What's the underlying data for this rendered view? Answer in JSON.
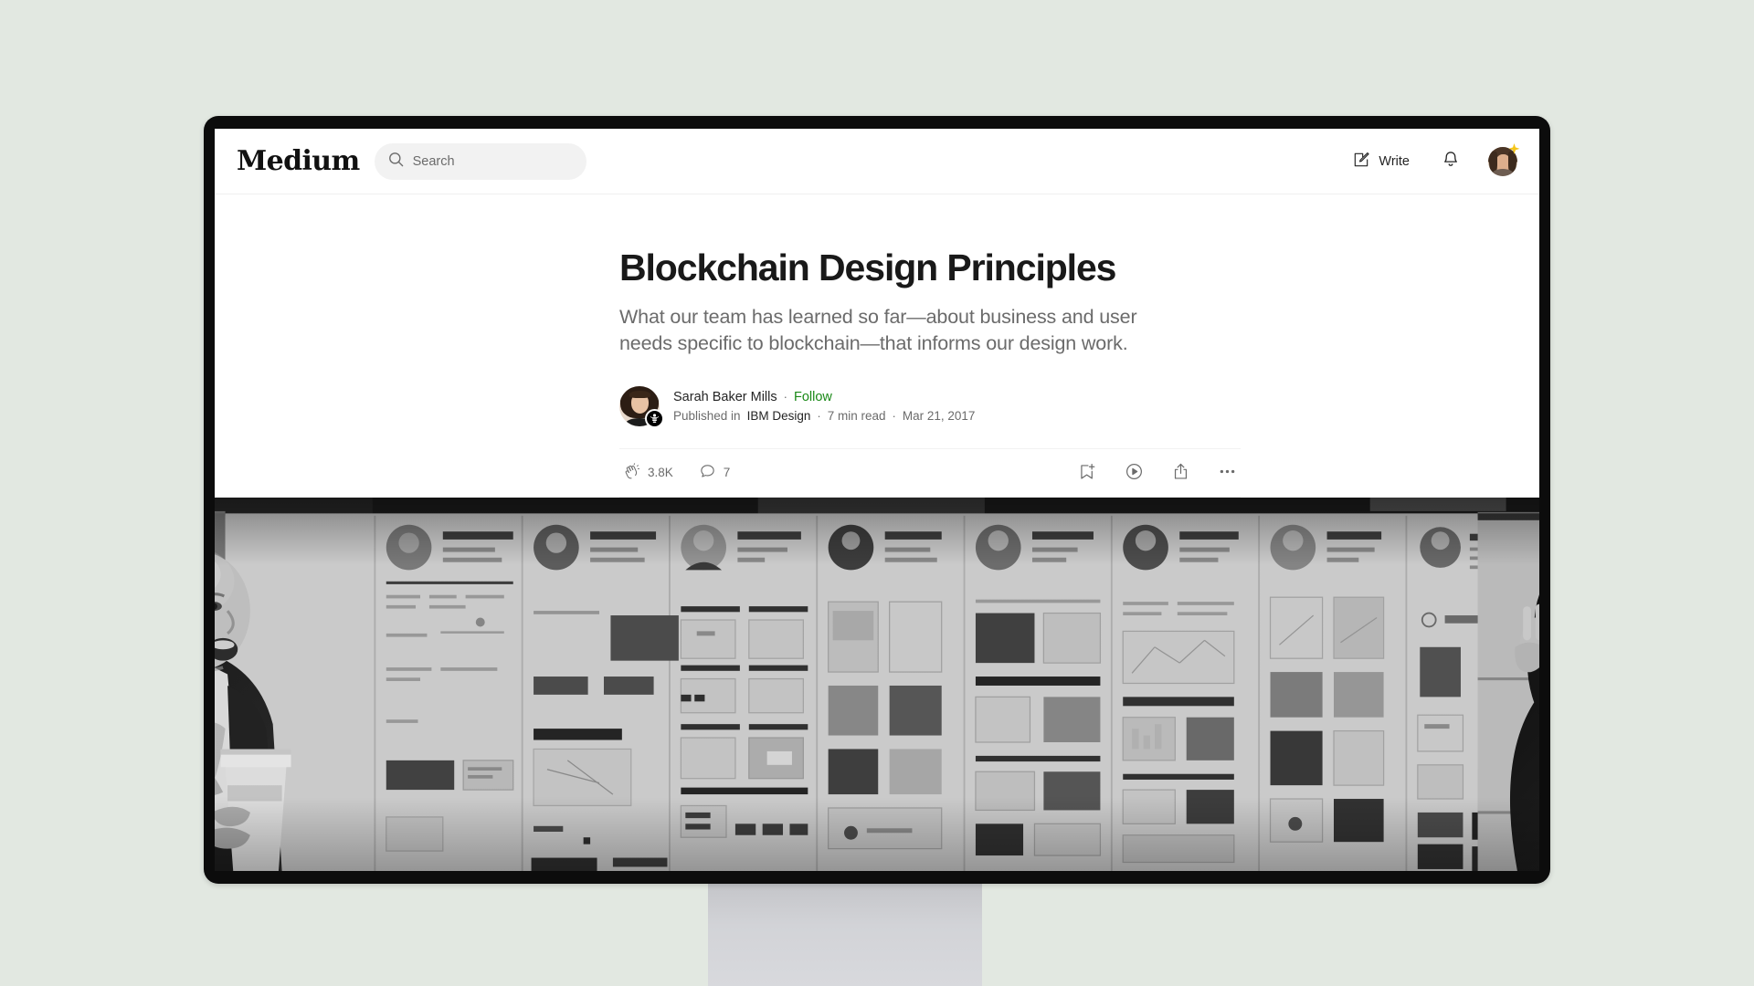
{
  "brand": {
    "name": "Medium"
  },
  "search": {
    "placeholder": "Search",
    "value": "",
    "icon": "search-icon"
  },
  "topnav": {
    "write_label": "Write",
    "write_icon": "pencil-square-icon",
    "notifications_icon": "bell-icon",
    "avatar_icon": "user-avatar",
    "avatar_badge_icon": "sparkle-star-icon"
  },
  "article": {
    "title": "Blockchain Design Principles",
    "subtitle": "What our team has learned so far—about business and user needs specific to blockchain—that informs our design work.",
    "author": {
      "name": "Sarah Baker Mills",
      "follow_label": "Follow",
      "avatar_icon": "author-avatar",
      "publication_badge_icon": "ibm-bee-icon"
    },
    "meta": {
      "published_in_label": "Published in",
      "publication": "IBM Design",
      "read_time": "7 min read",
      "date": "Mar 21, 2017",
      "separator": "·"
    },
    "actions": {
      "claps_icon": "clap-icon",
      "claps_count": "3.8K",
      "comments_icon": "comment-bubble-icon",
      "comments_count": "7",
      "save_icon": "bookmark-plus-icon",
      "listen_icon": "play-circle-icon",
      "share_icon": "share-upload-icon",
      "more_icon": "ellipsis-icon"
    },
    "hero_image_alt": "Black and white photo of two people at a wall covered in design portfolio posters"
  },
  "colors": {
    "page_background": "#e2e8e1",
    "monitor_bezel": "#0c0c0c",
    "monitor_stand": "#d2d3d7",
    "screen_background": "#ffffff",
    "text_primary": "#191919",
    "text_secondary": "#6b6b6b",
    "follow_green": "#1a8917",
    "search_field": "#f2f2f2",
    "sparkle_yellow": "#f5c518"
  }
}
